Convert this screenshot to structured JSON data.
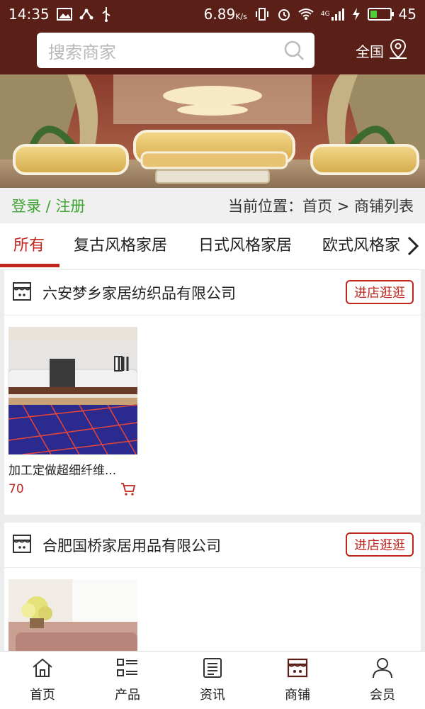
{
  "status_bar": {
    "time": "14:35",
    "speed": "6.89",
    "speed_unit": "K/s",
    "network": "4G",
    "battery_level": 45,
    "battery_text": "45"
  },
  "header": {
    "search_placeholder": "搜索商家",
    "region": "全国"
  },
  "breadcrumb": {
    "login": "登录 / 注册",
    "location": "当前位置：首页 > 商铺列表"
  },
  "tabs": [
    "所有",
    "复古风格家居",
    "日式风格家居",
    "欧式风格家"
  ],
  "shops": [
    {
      "name": "六安梦乡家居纺织品有限公司",
      "visit_label": "进店逛逛",
      "product": {
        "title": "加工定做超细纤维...",
        "price": "70"
      }
    },
    {
      "name": "合肥国桥家居用品有限公司",
      "visit_label": "进店逛逛"
    }
  ],
  "bottom_nav": [
    "首页",
    "产品",
    "资讯",
    "商铺",
    "会员"
  ],
  "colors": {
    "header_bg": "#5a1f16",
    "accent": "#c0261e",
    "login_green": "#3fa535"
  }
}
